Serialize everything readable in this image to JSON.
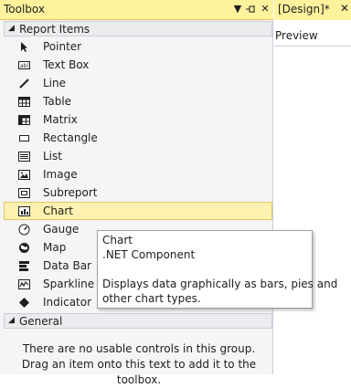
{
  "toolbox": {
    "title": "Toolbox",
    "buttons": {
      "dropdown": "▼",
      "pin": "⊣",
      "close": "✕"
    }
  },
  "report_items": {
    "header": "Report Items",
    "items": [
      {
        "label": "Pointer",
        "icon": "pointer-icon"
      },
      {
        "label": "Text Box",
        "icon": "text-box-icon"
      },
      {
        "label": "Line",
        "icon": "line-icon"
      },
      {
        "label": "Table",
        "icon": "table-icon"
      },
      {
        "label": "Matrix",
        "icon": "matrix-icon"
      },
      {
        "label": "Rectangle",
        "icon": "rectangle-icon"
      },
      {
        "label": "List",
        "icon": "list-icon"
      },
      {
        "label": "Image",
        "icon": "image-icon"
      },
      {
        "label": "Subreport",
        "icon": "subreport-icon"
      },
      {
        "label": "Chart",
        "icon": "chart-icon",
        "selected": true
      },
      {
        "label": "Gauge",
        "icon": "gauge-icon"
      },
      {
        "label": "Map",
        "icon": "map-icon"
      },
      {
        "label": "Data Bar",
        "icon": "data-bar-icon"
      },
      {
        "label": "Sparkline",
        "icon": "sparkline-icon"
      },
      {
        "label": "Indicator",
        "icon": "indicator-icon"
      }
    ]
  },
  "general": {
    "header": "General",
    "message": "There are no usable controls in this group. Drag an item onto this text to add it to the toolbox."
  },
  "design": {
    "tab_label": "[Design]*",
    "tab_close": "✕",
    "preview_label": "Preview"
  },
  "tooltip": {
    "title": "Chart",
    "subtitle": ".NET Component",
    "description_line1": "Displays data graphically as bars, pies and",
    "description_line2": "other chart types."
  },
  "colors": {
    "accent": "#fff29d",
    "selection": "#fff2b0",
    "selection_border": "#e5c365"
  }
}
